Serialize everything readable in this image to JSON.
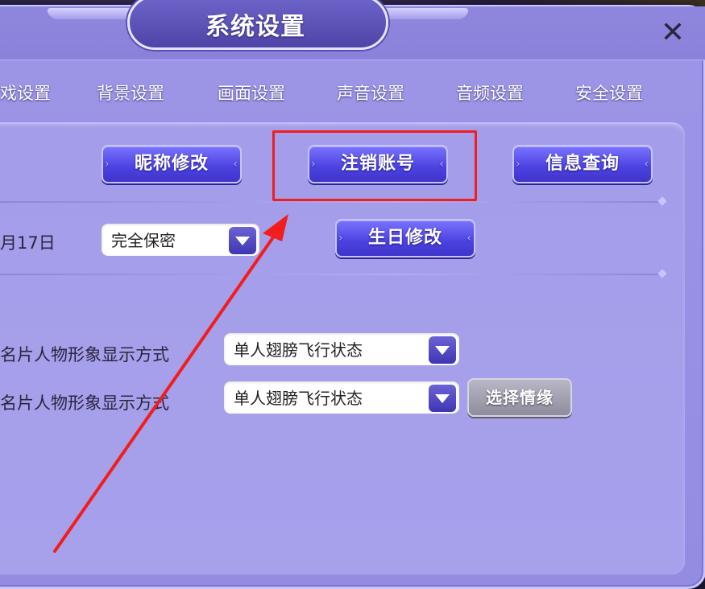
{
  "window": {
    "title": "系统设置",
    "close_label": "✕"
  },
  "tabs": [
    "戏设置",
    "背景设置",
    "画面设置",
    "声音设置",
    "音频设置",
    "安全设置"
  ],
  "row1": {
    "nickname_button": "昵称修改",
    "cancel_account_button": "注销账号",
    "info_query_button": "信息查询"
  },
  "row2": {
    "birthday_label": "月17日",
    "privacy_select_value": "完全保密",
    "birthday_button": "生日修改"
  },
  "row3": {
    "label1": "名片人物形象显示方式",
    "select1_value": "单人翅膀飞行状态",
    "label2": "名片人物形象显示方式",
    "select2_value": "单人翅膀飞行状态",
    "select_partner_button": "选择情缘"
  },
  "colors": {
    "highlight": "#f21d1d",
    "button_blue": "#4b41e0",
    "panel": "#9d95e6"
  }
}
